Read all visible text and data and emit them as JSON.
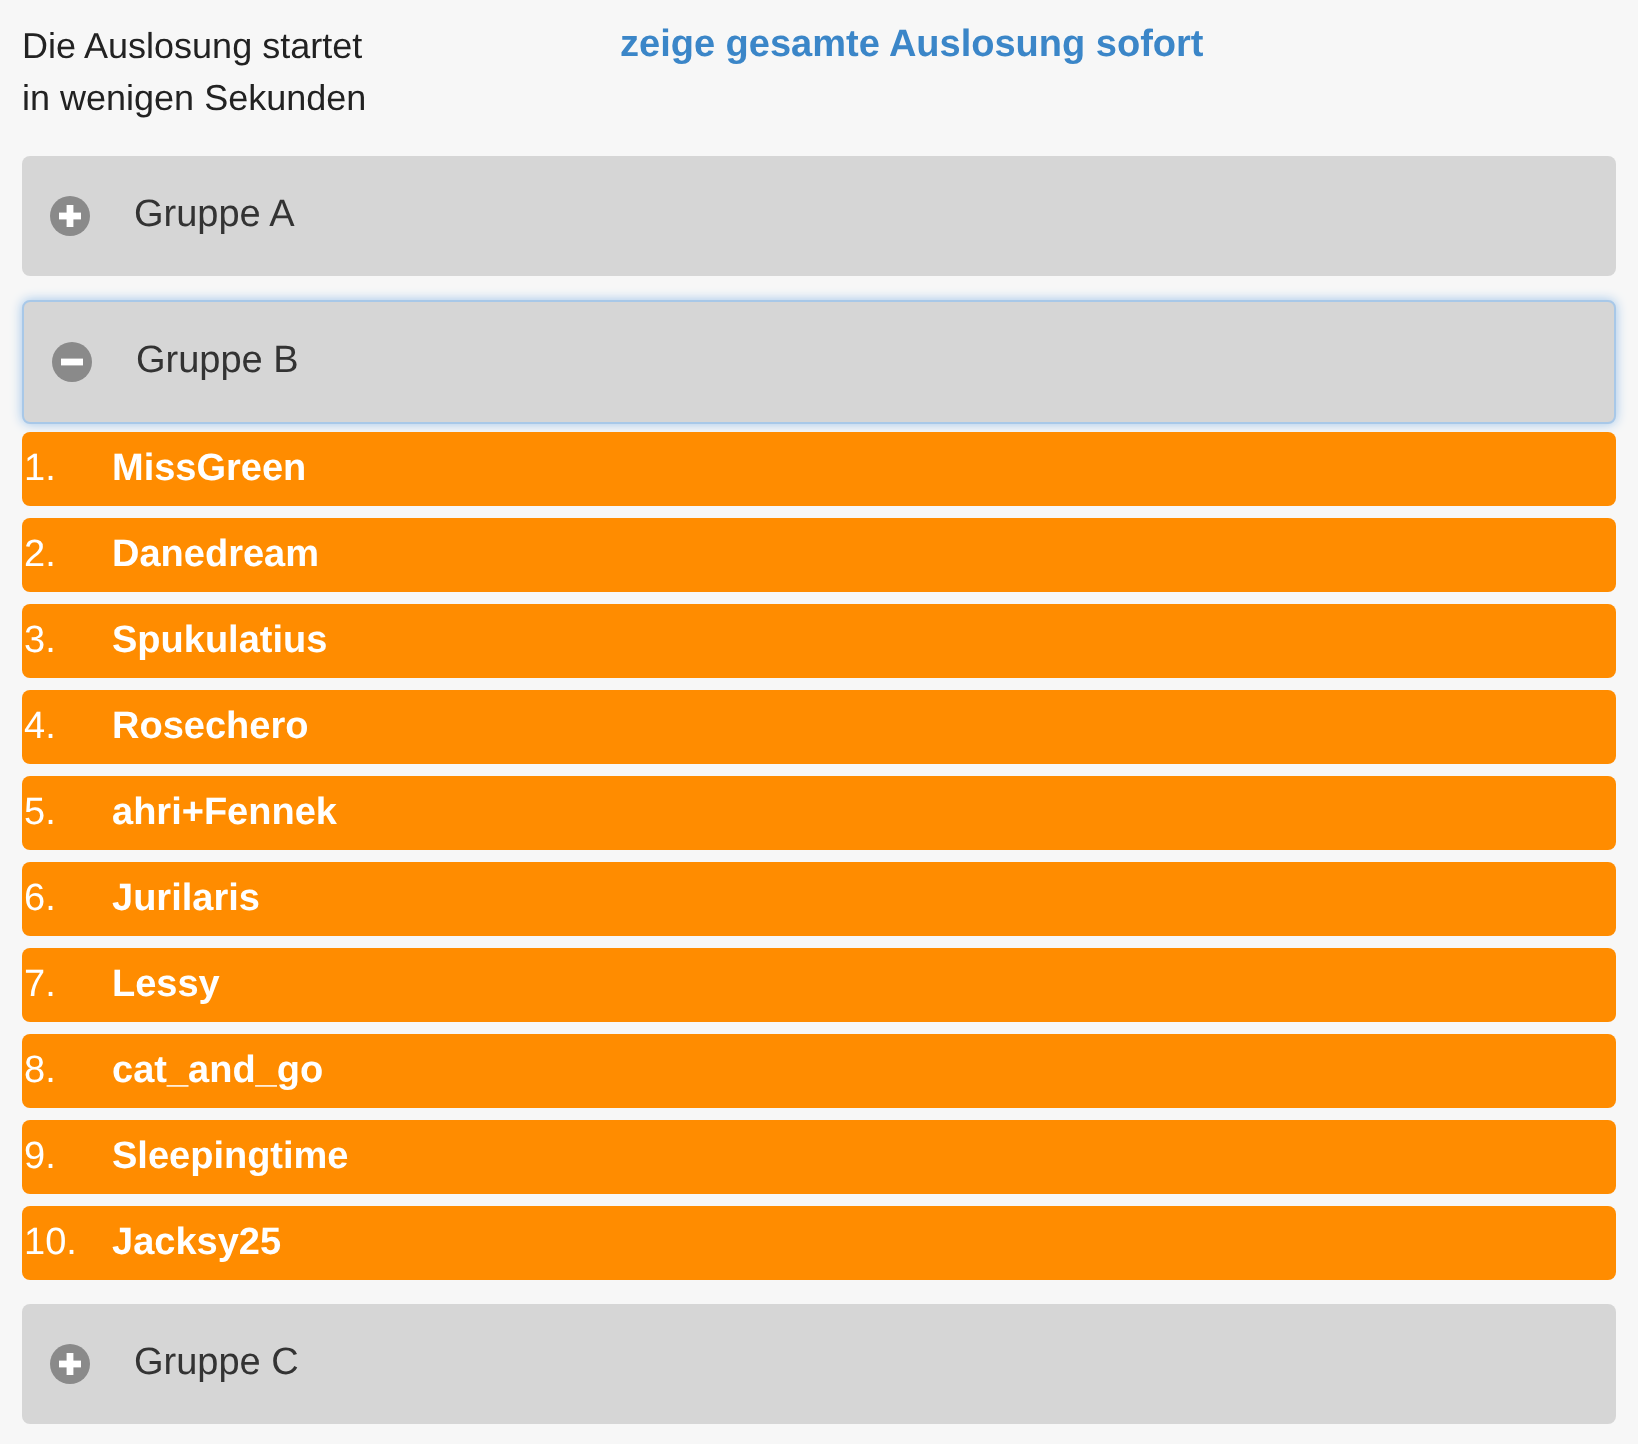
{
  "header": {
    "status": "Die Auslosung startet in wenigen Sekunden",
    "link": "zeige gesamte Auslosung sofort"
  },
  "groups": [
    {
      "label": "Gruppe A",
      "expanded": false
    },
    {
      "label": "Gruppe B",
      "expanded": true,
      "entries": [
        {
          "rank": "1.",
          "name": "MissGreen"
        },
        {
          "rank": "2.",
          "name": "Danedream"
        },
        {
          "rank": "3.",
          "name": "Spukulatius"
        },
        {
          "rank": "4.",
          "name": "Rosechero"
        },
        {
          "rank": "5.",
          "name": "ahri+Fennek"
        },
        {
          "rank": "6.",
          "name": "Jurilaris"
        },
        {
          "rank": "7.",
          "name": "Lessy"
        },
        {
          "rank": "8.",
          "name": "cat_and_go"
        },
        {
          "rank": "9.",
          "name": "Sleepingtime"
        },
        {
          "rank": "10.",
          "name": "Jacksy25"
        }
      ]
    },
    {
      "label": "Gruppe C",
      "expanded": false
    }
  ]
}
